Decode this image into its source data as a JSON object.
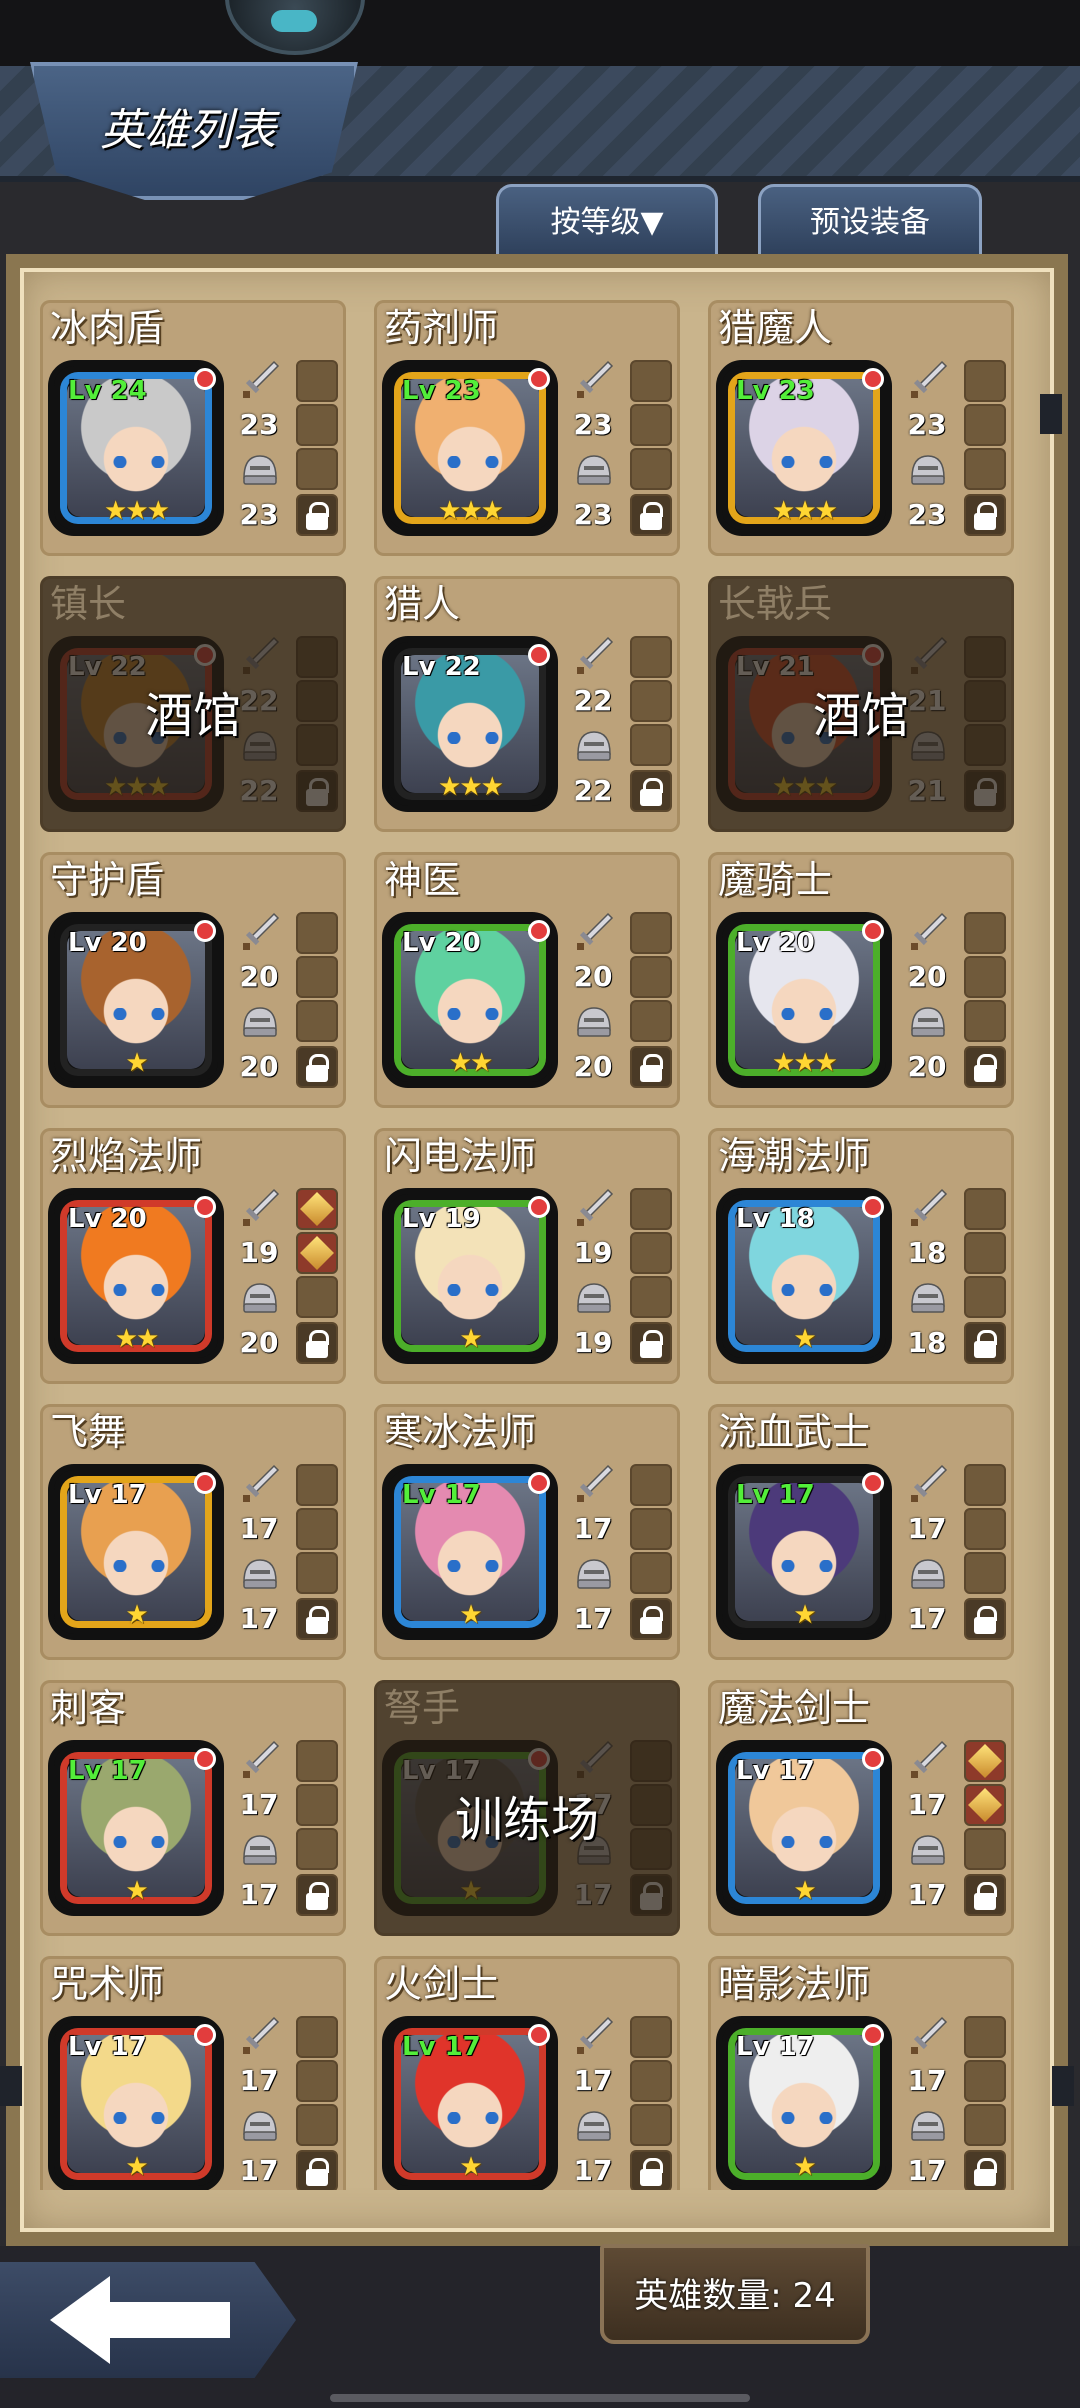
{
  "screen_title": "英雄列表",
  "sort_button": "按等级▼",
  "preset_button": "预设装备",
  "hero_count": "英雄数量: 24",
  "heroes": [
    {
      "name": "冰肉盾",
      "level": "Lv 24",
      "atk": "23",
      "def": "23",
      "stars": "★★★",
      "frame": "#2c86d6",
      "hair": "#c9c9c9",
      "green": true,
      "locked": false
    },
    {
      "name": "药剂师",
      "level": "Lv 23",
      "atk": "23",
      "def": "23",
      "stars": "★★★",
      "frame": "#e3a51a",
      "hair": "#f0b070",
      "green": true,
      "locked": false
    },
    {
      "name": "猎魔人",
      "level": "Lv 23",
      "atk": "23",
      "def": "23",
      "stars": "★★★",
      "frame": "#e3a51a",
      "hair": "#dcd3e6",
      "green": true,
      "locked": false
    },
    {
      "name": "镇长",
      "level": "Lv 22",
      "atk": "22",
      "def": "22",
      "stars": "★★★",
      "frame": "#c0392b",
      "hair": "#c9872e",
      "green": false,
      "locked": true,
      "lock_label": "酒馆"
    },
    {
      "name": "猎人",
      "level": "Lv 22",
      "atk": "22",
      "def": "22",
      "stars": "★★★",
      "frame": "#222222",
      "hair": "#3a9aa6",
      "green": false,
      "locked": false
    },
    {
      "name": "长戟兵",
      "level": "Lv 21",
      "atk": "21",
      "def": "21",
      "stars": "★★★",
      "frame": "#c0392b",
      "hair": "#d94c2a",
      "green": false,
      "locked": true,
      "lock_label": "酒馆"
    },
    {
      "name": "守护盾",
      "level": "Lv 20",
      "atk": "20",
      "def": "20",
      "stars": "★",
      "frame": "#222222",
      "hair": "#a8632e",
      "green": false,
      "locked": false
    },
    {
      "name": "神医",
      "level": "Lv 20",
      "atk": "20",
      "def": "20",
      "stars": "★★",
      "frame": "#4caf2a",
      "hair": "#5fd1a0",
      "green": false,
      "locked": false
    },
    {
      "name": "魔骑士",
      "level": "Lv 20",
      "atk": "20",
      "def": "20",
      "stars": "★★★",
      "frame": "#4caf2a",
      "hair": "#e6e6ee",
      "green": false,
      "locked": false
    },
    {
      "name": "烈焰法师",
      "level": "Lv 20",
      "atk": "19",
      "def": "20",
      "stars": "★★",
      "frame": "#d03a2a",
      "hair": "#f07a20",
      "green": false,
      "locked": false,
      "gear": true
    },
    {
      "name": "闪电法师",
      "level": "Lv 19",
      "atk": "19",
      "def": "19",
      "stars": "★",
      "frame": "#4caf2a",
      "hair": "#f3e2b8",
      "green": false,
      "locked": false
    },
    {
      "name": "海潮法师",
      "level": "Lv 18",
      "atk": "18",
      "def": "18",
      "stars": "★",
      "frame": "#2c86d6",
      "hair": "#7fd6de",
      "green": false,
      "locked": false
    },
    {
      "name": "飞舞",
      "level": "Lv 17",
      "atk": "17",
      "def": "17",
      "stars": "★",
      "frame": "#e3a51a",
      "hair": "#e8a050",
      "green": false,
      "locked": false
    },
    {
      "name": "寒冰法师",
      "level": "Lv 17",
      "atk": "17",
      "def": "17",
      "stars": "★",
      "frame": "#2c86d6",
      "hair": "#e48ab0",
      "green": true,
      "locked": false
    },
    {
      "name": "流血武士",
      "level": "Lv 17",
      "atk": "17",
      "def": "17",
      "stars": "★",
      "frame": "#222222",
      "hair": "#4c3a7a",
      "green": true,
      "locked": false
    },
    {
      "name": "刺客",
      "level": "Lv 17",
      "atk": "17",
      "def": "17",
      "stars": "★",
      "frame": "#d03a2a",
      "hair": "#9aa86e",
      "green": true,
      "locked": false
    },
    {
      "name": "弩手",
      "level": "Lv 17",
      "atk": "17",
      "def": "17",
      "stars": "★",
      "frame": "#4caf2a",
      "hair": "#555555",
      "green": false,
      "locked": true,
      "lock_label": "训练场"
    },
    {
      "name": "魔法剑士",
      "level": "Lv 17",
      "atk": "17",
      "def": "17",
      "stars": "★",
      "frame": "#2c86d6",
      "hair": "#f0c89a",
      "green": false,
      "locked": false,
      "gear": true
    },
    {
      "name": "咒术师",
      "level": "Lv 17",
      "atk": "17",
      "def": "17",
      "stars": "★",
      "frame": "#d03a2a",
      "hair": "#f3d98a",
      "green": false,
      "locked": false
    },
    {
      "name": "火剑士",
      "level": "Lv 17",
      "atk": "17",
      "def": "17",
      "stars": "★",
      "frame": "#d03a2a",
      "hair": "#e0342a",
      "green": true,
      "locked": false
    },
    {
      "name": "暗影法师",
      "level": "Lv 17",
      "atk": "17",
      "def": "17",
      "stars": "★",
      "frame": "#4caf2a",
      "hair": "#eeeeee",
      "green": false,
      "locked": false
    }
  ],
  "icons": {
    "atk": "sword-icon",
    "def": "helmet-icon",
    "lock": "lock-icon",
    "back": "back-arrow-icon"
  }
}
